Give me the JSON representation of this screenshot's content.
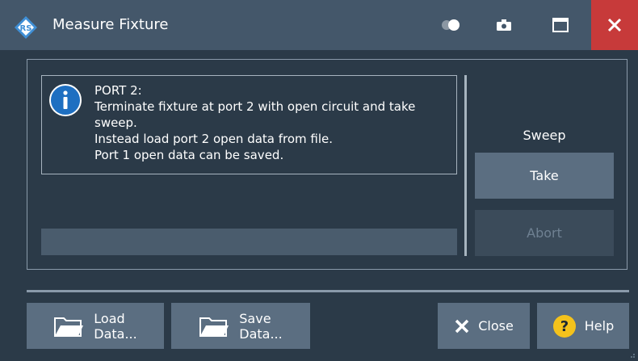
{
  "window": {
    "title": "Measure Fixture",
    "icons": [
      "rohde-schwarz-logo",
      "toggle-icon",
      "camera-icon",
      "maximize-icon",
      "close-icon"
    ]
  },
  "message": {
    "icon": "info-icon",
    "lines": [
      "PORT 2:",
      "Terminate fixture at port 2 with open circuit and take",
      "sweep.",
      "Instead load port 2 open data from file.",
      "Port 1 open data can be saved."
    ]
  },
  "progress": {
    "value": 0
  },
  "sweep": {
    "label": "Sweep",
    "take_label": "Take",
    "abort_label": "Abort"
  },
  "footer": {
    "load_label_1": "Load",
    "load_label_2": "Data...",
    "save_label_1": "Save",
    "save_label_2": "Data...",
    "close_label": "Close",
    "help_label": "Help"
  },
  "colors": {
    "background": "#2b3a48",
    "titlebar": "#44576a",
    "close_red": "#c73a3a",
    "button": "#5b6e81",
    "button_disabled": "#3b4b5a",
    "info_blue": "#1e6fc1",
    "help_yellow": "#f4c21c"
  }
}
